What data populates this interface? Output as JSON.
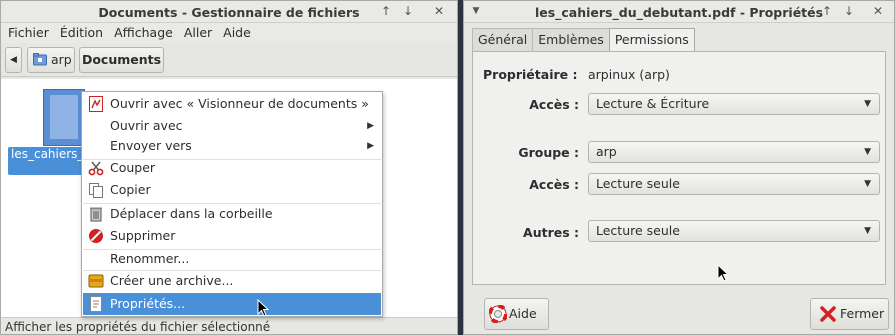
{
  "left_window": {
    "title": "Documents - Gestionnaire de fichiers",
    "titlebar_buttons": [
      "↑",
      "↓",
      "✕"
    ],
    "menu": [
      "Fichier",
      "Édition",
      "Affichage",
      "Aller",
      "Aide"
    ],
    "toolbar": {
      "back_arrow": "◀",
      "path_root": "arp",
      "path_current": "Documents"
    },
    "file": {
      "label": "les_cahiers_d utant.pdf"
    },
    "status": "Afficher les propriétés du fichier sélectionné"
  },
  "context_menu": {
    "items": [
      {
        "label": "Ouvrir avec « Visionneur de documents »",
        "icon": "pdf-viewer-icon"
      },
      {
        "label": "Ouvrir avec",
        "submenu": "▶"
      },
      {
        "label": "Envoyer vers",
        "submenu": "▶"
      },
      {
        "label": "Couper",
        "icon": "scissors-icon"
      },
      {
        "label": "Copier",
        "icon": "copy-icon"
      },
      {
        "label": "Déplacer dans la corbeille",
        "icon": "trash-icon"
      },
      {
        "label": "Supprimer",
        "icon": "delete-icon"
      },
      {
        "label": "Renommer..."
      },
      {
        "label": "Créer une archive...",
        "icon": "archive-icon"
      },
      {
        "label": "Propriétés...",
        "icon": "properties-icon",
        "active": true
      }
    ]
  },
  "right_window": {
    "title": "les_cahiers_du_debutant.pdf - Propriétés",
    "titlebar_buttons": [
      "↑",
      "↓",
      "✕"
    ],
    "tabs": [
      "Général",
      "Emblèmes",
      "Permissions"
    ],
    "active_tab": "Permissions",
    "owner_label": "Propriétaire :",
    "owner_value": "arpinux (arp)",
    "owner_access_label": "Accès :",
    "owner_access_value": "Lecture & Écriture",
    "group_label": "Groupe :",
    "group_value": "arp",
    "group_access_label": "Accès :",
    "group_access_value": "Lecture seule",
    "others_label": "Autres :",
    "others_value": "Lecture seule",
    "help_button": "Aide",
    "close_button": "Fermer"
  },
  "colors": {
    "selection": "#4a90d9",
    "window_bg": "#e6e6e3",
    "desktop": "#2a3440"
  }
}
